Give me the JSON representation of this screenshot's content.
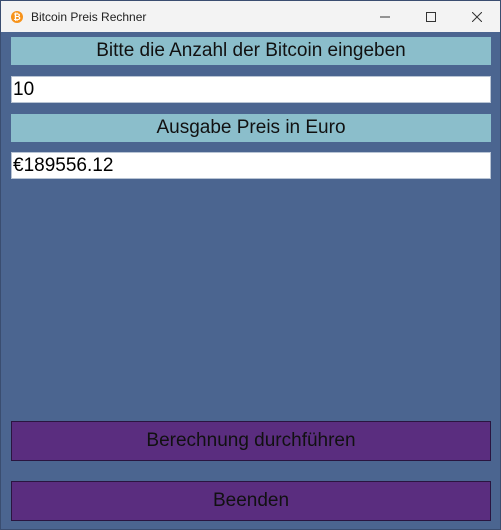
{
  "window": {
    "title": "Bitcoin Preis Rechner",
    "app_icon_glyph": "₿",
    "controls": [
      "minimize-icon",
      "maximize-icon",
      "close-icon"
    ]
  },
  "form": {
    "input_label": "Bitte die Anzahl der Bitcoin eingeben",
    "input_value": "10",
    "output_label": "Ausgabe Preis in Euro",
    "output_value": "€189556.12"
  },
  "buttons": {
    "calculate_label": "Berechnung durchführen",
    "quit_label": "Beenden"
  },
  "colors": {
    "background": "#4b6590",
    "label_bar": "#8bbecb",
    "button": "#5a2d7f",
    "titlebar": "#f3f3f3"
  }
}
